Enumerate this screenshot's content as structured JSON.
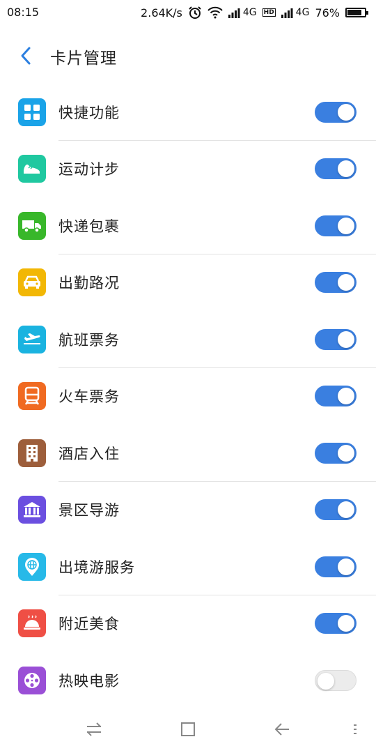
{
  "status_bar": {
    "time": "08:15",
    "network_speed": "2.64K/s",
    "network_type_1": "4G",
    "network_type_2": "4G",
    "battery": "76%",
    "battery_level": 0.76,
    "icons": [
      "alarm-icon",
      "wifi-icon",
      "signal-icon",
      "hd-icon",
      "signal-icon",
      "battery-icon"
    ]
  },
  "header": {
    "back_icon": "chevron-left-icon",
    "title": "卡片管理"
  },
  "cards": [
    {
      "label": "快捷功能",
      "icon": "grid-icon",
      "color": "#1aa3e8",
      "enabled": true
    },
    {
      "label": "运动计步",
      "icon": "sneaker-icon",
      "color": "#1fc8a0",
      "enabled": true
    },
    {
      "label": "快递包裹",
      "icon": "truck-icon",
      "color": "#38b72a",
      "enabled": true
    },
    {
      "label": "出勤路况",
      "icon": "car-icon",
      "color": "#f2b705",
      "enabled": true
    },
    {
      "label": "航班票务",
      "icon": "plane-icon",
      "color": "#1ab3e0",
      "enabled": true
    },
    {
      "label": "火车票务",
      "icon": "train-icon",
      "color": "#f06a21",
      "enabled": true
    },
    {
      "label": "酒店入住",
      "icon": "building-icon",
      "color": "#9d5e3b",
      "enabled": true
    },
    {
      "label": "景区导游",
      "icon": "museum-icon",
      "color": "#6b4fe0",
      "enabled": true
    },
    {
      "label": "出境游服务",
      "icon": "globe-pin-icon",
      "color": "#27b9e8",
      "enabled": true
    },
    {
      "label": "附近美食",
      "icon": "dish-icon",
      "color": "#ef4f45",
      "enabled": true
    },
    {
      "label": "热映电影",
      "icon": "film-reel-icon",
      "color": "#9a4fd6",
      "enabled": false
    }
  ],
  "colors": {
    "toggle_on": "#3a7fe0",
    "toggle_off": "#ececec",
    "accent": "#2b7fe0"
  },
  "nav_bar": {
    "icons": [
      "switch-icon",
      "home-square-icon",
      "back-arrow-icon",
      "menu-dots-icon"
    ]
  }
}
